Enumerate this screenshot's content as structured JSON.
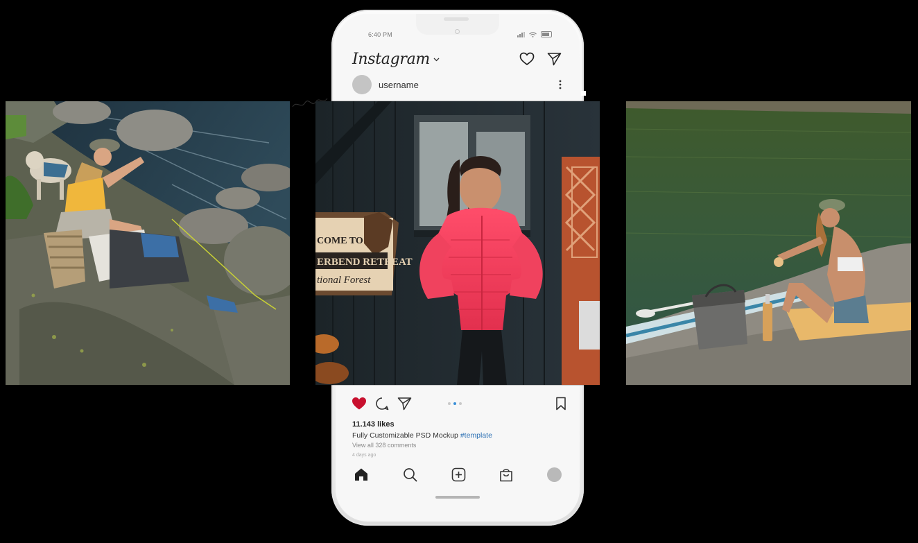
{
  "status_bar": {
    "time": "6:40 PM"
  },
  "header": {
    "logo_text": "Instagram",
    "icons": [
      "chevron-down-icon",
      "heart-icon",
      "send-icon"
    ]
  },
  "post": {
    "username": "username",
    "likes": "11.143 likes",
    "caption_text": "Fully Customizable PSD Mockup",
    "caption_tag": "#template",
    "comments_link": "View all 328 comments",
    "posted_ago": "4 days ago",
    "liked": true,
    "carousel": {
      "count": 3,
      "active_index": 1
    },
    "sign_text": {
      "line1": "COME TO",
      "line2": "ERBEND RETREAT",
      "line3": "tional Forest"
    }
  },
  "tab_bar": {
    "icons": [
      "home-icon",
      "search-icon",
      "add-post-icon",
      "shop-bag-icon",
      "profile-avatar"
    ]
  },
  "colors": {
    "like_red": "#c8102e",
    "hashtag_blue": "#2a6fb3",
    "carousel_active": "#3a8fd8",
    "jacket_pink": "#f0425e"
  }
}
